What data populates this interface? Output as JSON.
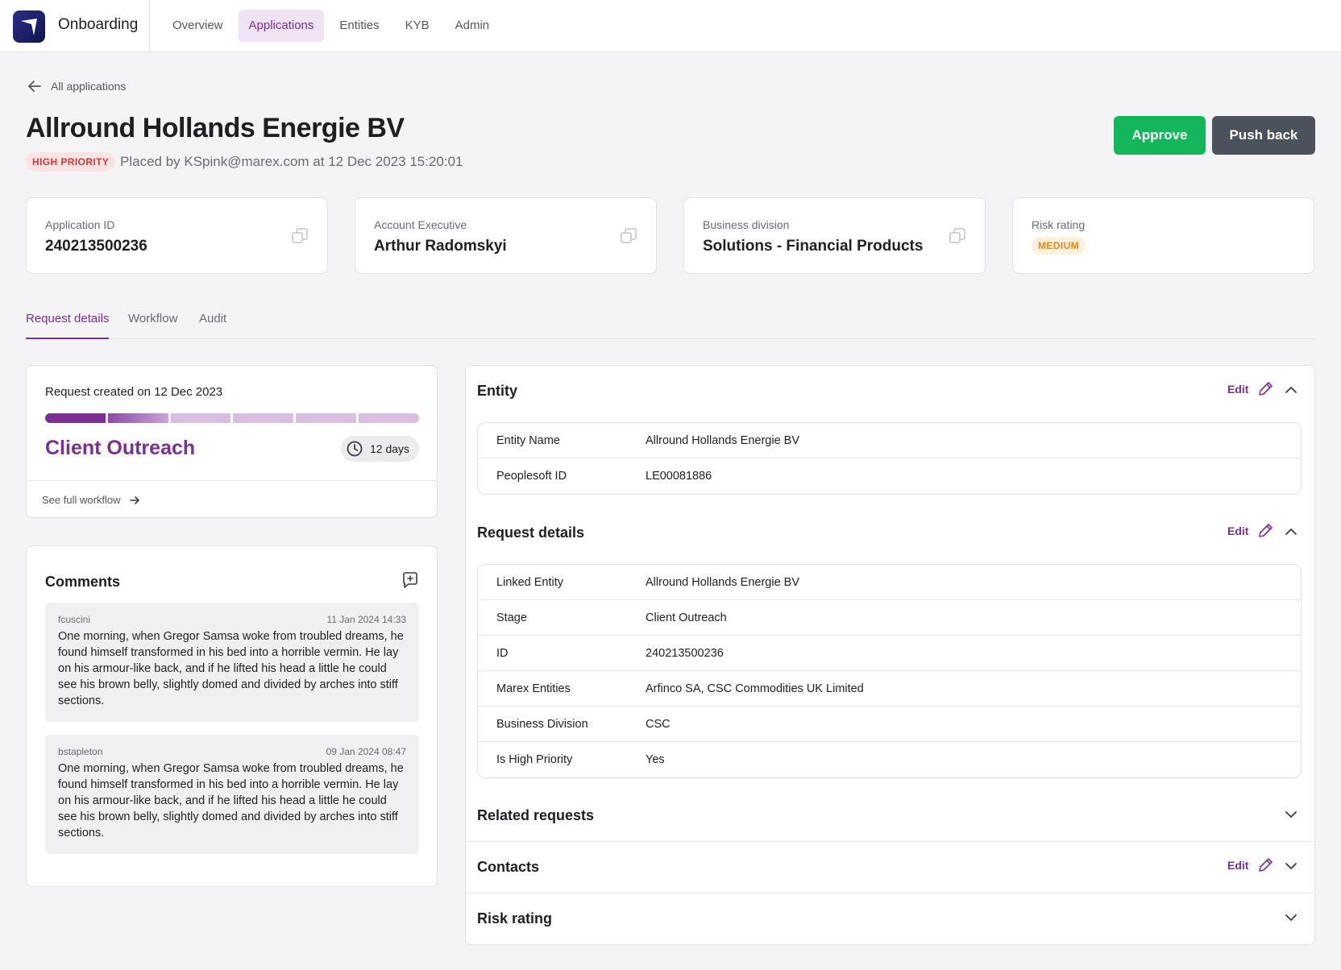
{
  "app": {
    "name": "Onboarding"
  },
  "nav": [
    "Overview",
    "Applications",
    "Entities",
    "KYB",
    "Admin"
  ],
  "back_label": "All applications",
  "header": {
    "title": "Allround Hollands Energie BV",
    "priority_badge": "HIGH PRIORITY",
    "placed_by": "Placed by KSpink@marex.com at 12 Dec 2023 15:20:01",
    "approve": "Approve",
    "push_back": "Push back"
  },
  "cards": {
    "app_id": {
      "label": "Application ID",
      "value": "240213500236"
    },
    "exec": {
      "label": "Account Executive",
      "value": "Arthur Radomskyi"
    },
    "division": {
      "label": "Business division",
      "value": "Solutions - Financial Products"
    },
    "risk": {
      "label": "Risk rating",
      "value": "MEDIUM"
    }
  },
  "tabs": [
    "Request details",
    "Workflow",
    "Audit"
  ],
  "progress": {
    "created": "Request created on 12 Dec 2023",
    "completed_segments": 1.5,
    "total_segments": 6,
    "stage": "Client Outreach",
    "days": "12 days",
    "see_full": "See full workflow"
  },
  "comments": {
    "title": "Comments",
    "items": [
      {
        "user": "fcuscini",
        "time": "11 Jan 2024 14:33",
        "text": "One morning, when Gregor Samsa woke from troubled dreams, he found himself transformed in his bed into a horrible vermin. He lay on his armour-like back, and if he lifted his head a little he could see his brown belly, slightly domed and divided by arches into stiff sections."
      },
      {
        "user": "bstapleton",
        "time": "09 Jan 2024 08:47",
        "text": "One morning, when Gregor Samsa woke from troubled dreams, he found himself transformed in his bed into a horrible vermin. He lay on his armour-like back, and if he lifted his head a little he could see his brown belly, slightly domed and divided by arches into stiff sections."
      }
    ]
  },
  "sections": {
    "entity": {
      "title": "Entity",
      "edit": "Edit",
      "rows": [
        {
          "key": "Entity Name",
          "value": "Allround Hollands Energie BV"
        },
        {
          "key": "Peoplesoft ID",
          "value": "LE00081886"
        }
      ]
    },
    "request": {
      "title": "Request details",
      "edit": "Edit",
      "rows": [
        {
          "key": "Linked Entity",
          "value": "Allround Hollands Energie BV"
        },
        {
          "key": "Stage",
          "value": "Client Outreach"
        },
        {
          "key": "ID",
          "value": "240213500236"
        },
        {
          "key": "Marex Entities",
          "value": "Arfinco SA, CSC Commodities UK Limited"
        },
        {
          "key": "Business Division",
          "value": "CSC"
        },
        {
          "key": "Is High Priority",
          "value": "Yes"
        }
      ]
    },
    "related": {
      "title": "Related requests"
    },
    "contacts": {
      "title": "Contacts",
      "edit": "Edit"
    },
    "risk": {
      "title": "Risk rating"
    }
  },
  "colors": {
    "accent": "#7a2f93",
    "approve": "#13b65a",
    "push_back": "#4b525c",
    "high_priority": "#d23b3b",
    "medium": "#e08a1d"
  }
}
